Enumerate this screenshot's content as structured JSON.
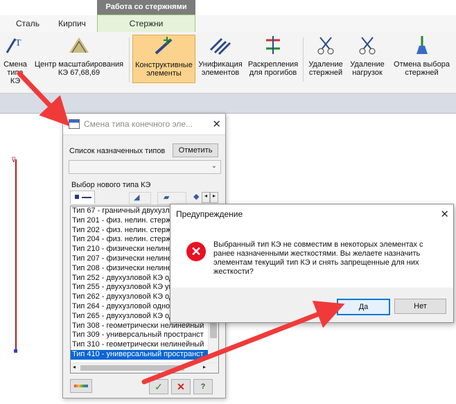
{
  "ribbon": {
    "context_tab_group": "Работа со стержнями",
    "tabs": [
      {
        "label": "Сталь"
      },
      {
        "label": "Кирпич"
      },
      {
        "label": "Стержни"
      }
    ],
    "buttons": [
      {
        "line1": "Смена",
        "line2": "типа КЭ"
      },
      {
        "line1": "Центр масштабирования",
        "line2": "КЭ 67,68,69"
      },
      {
        "line1": "Конструктивные",
        "line2": "элементы"
      },
      {
        "line1": "Унификация",
        "line2": "элементов"
      },
      {
        "line1": "Раскрепления",
        "line2": "для прогибов"
      },
      {
        "line1": "Удаление",
        "line2": "стержней"
      },
      {
        "line1": "Удаление",
        "line2": "нагрузок"
      },
      {
        "line1": "Отмена выбора",
        "line2": "стержней"
      }
    ]
  },
  "fe_type_dialog": {
    "title": "Смена типа конечного эле...",
    "assigned_list_label": "Список назначенных типов",
    "mark_button": "Отметить",
    "assigned_combo_value": "",
    "new_type_label": "Выбор нового  типа  КЭ",
    "types": [
      "Тип 67 - граничный двухузловой",
      "Тип 201 -  физ. нелин. стержень",
      "Тип 202 -  физ. нелин. стержень",
      "Тип 204 -  физ. нелин. стержень",
      "Тип 210 - физически нелинейный",
      "Тип 207 - физически нелинейный",
      "Тип 208 - физически нелинейный",
      "Тип 252 - двухузловой КЭ одност",
      "Тип 255 - двухузловой КЭ упругой",
      "Тип 262 - двухузловой КЭ одност",
      "Тип 264  - двухузловой односторон",
      "Тип 265 - двухузловой КЭ одност",
      "Тип 308 - геометрически нелинейный",
      "Тип 309 - универсальный пространст",
      "Тип 310 - геометрически нелинейный",
      "Тип 410 - универсальный пространст"
    ],
    "selected_index": 15
  },
  "warning_dialog": {
    "title": "Предупреждение",
    "message_lines": [
      "Выбранный тип КЭ не совместим в некоторых элементах с",
      "ранее назначенными жесткостями. Вы желаете назначить",
      "элементам текущий тип КЭ и снять запрещенные для них",
      "жесткости?"
    ],
    "yes_label": "Да",
    "no_label": "Нет"
  },
  "colors": {
    "arrow": "#f03a3a",
    "selection": "#0a66d2",
    "active_button": "#fbd38c",
    "error_icon": "#e81123"
  }
}
